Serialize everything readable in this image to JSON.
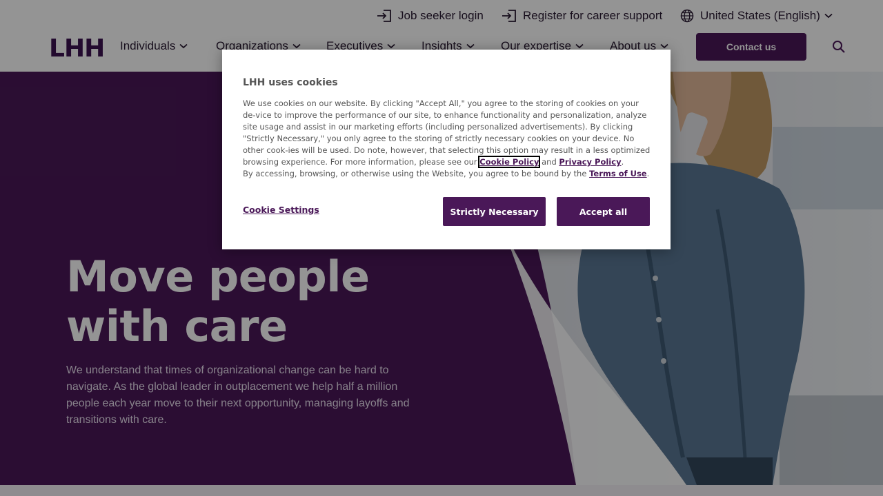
{
  "utility": {
    "login": "Job seeker login",
    "register": "Register for career support",
    "locale": "United States (English)"
  },
  "nav": {
    "logo": "LHH",
    "items": [
      "Individuals",
      "Organizations",
      "Executives",
      "Insights",
      "Our expertise",
      "About us"
    ],
    "contact": "Contact us"
  },
  "hero": {
    "title_line1": "Move people",
    "title_line2": "with care",
    "text": "We understand that times of organizational change can be hard to navigate. As the global leader in outplacement we help half a million people each year move to their next opportunity, managing layoffs and transitions with care."
  },
  "cookie": {
    "title": "LHH uses cookies",
    "body_part1": "We use cookies on our website. By clicking \"Accept All,\" you agree to the storing of cookies on your de-vice to improve the performance of our site, to enhance functionality and personalization, analyze site usage and assist in our marketing efforts (including personalized advertisements). By clicking \"Strictly Necessary,\" you only agree to the storing of strictly necessary cookies on your device. No other cook-ies will be used. Do note, however, that selecting this option may result in a less optimized browsing experience. For more information, please see our ",
    "cookie_policy_link": "Cookie Policy",
    "and": " and ",
    "privacy_link": "Privacy Policy",
    "period1": ".",
    "body_part2": "By accessing, browsing, or otherwise using the Website, you agree to be bound by the ",
    "terms_link": "Terms of Use",
    "period2": ".",
    "settings_label": "Cookie Settings",
    "necessary_label": "Strictly Necessary",
    "accept_label": "Accept all"
  },
  "colors": {
    "brand_purple": "#4a1858",
    "overlay": "rgba(0,0,0,0.42)"
  }
}
